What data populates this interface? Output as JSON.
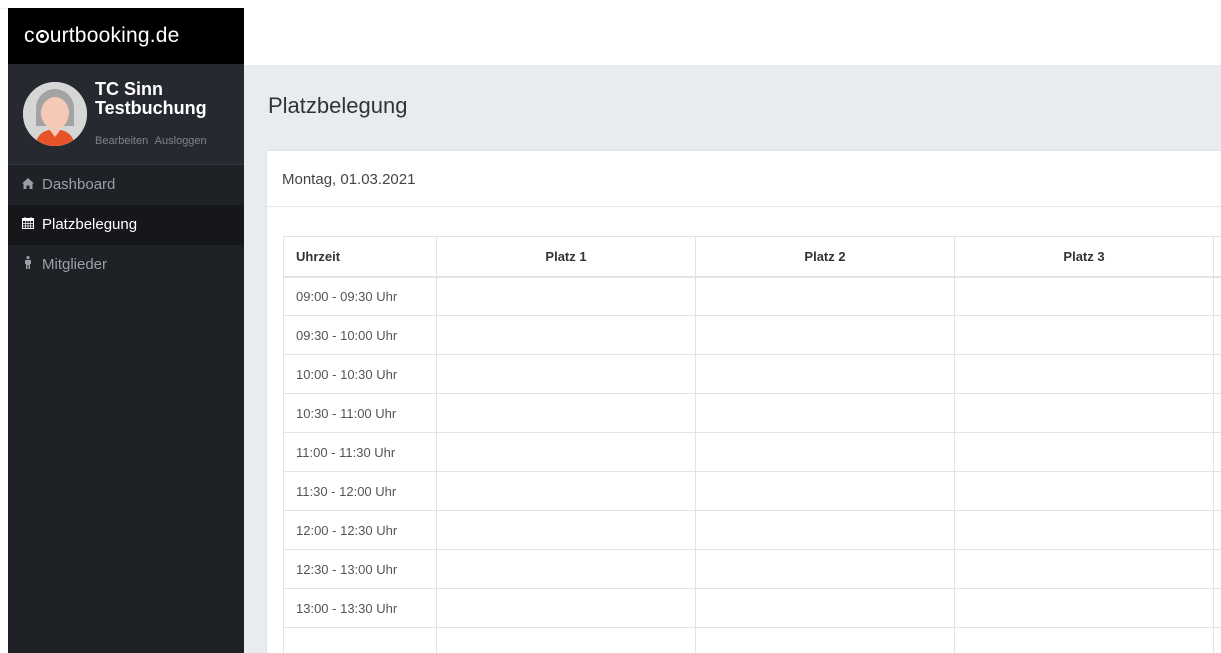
{
  "brand": {
    "prefix": "c",
    "suffix": "urtbooking.de"
  },
  "user": {
    "name": "TC Sinn Testbuchung",
    "edit_label": "Bearbeiten",
    "logout_label": "Ausloggen"
  },
  "nav": {
    "items": [
      {
        "label": "Dashboard",
        "icon": "home-icon",
        "active": false
      },
      {
        "label": "Platzbelegung",
        "icon": "calendar-icon",
        "active": true
      },
      {
        "label": "Mitglieder",
        "icon": "person-icon",
        "active": false
      }
    ]
  },
  "page": {
    "title": "Platzbelegung"
  },
  "card": {
    "date": "Montag, 01.03.2021"
  },
  "table": {
    "headers": [
      "Uhrzeit",
      "Platz 1",
      "Platz 2",
      "Platz 3"
    ],
    "rows": [
      "09:00 - 09:30 Uhr",
      "09:30 - 10:00 Uhr",
      "10:00 - 10:30 Uhr",
      "10:30 - 11:00 Uhr",
      "11:00 - 11:30 Uhr",
      "11:30 - 12:00 Uhr",
      "12:00 - 12:30 Uhr",
      "12:30 - 13:00 Uhr",
      "13:00 - 13:30 Uhr"
    ]
  },
  "colors": {
    "sidebar": "#1e2126",
    "brand_bg": "#000000",
    "content_bg": "#e9ecef"
  }
}
